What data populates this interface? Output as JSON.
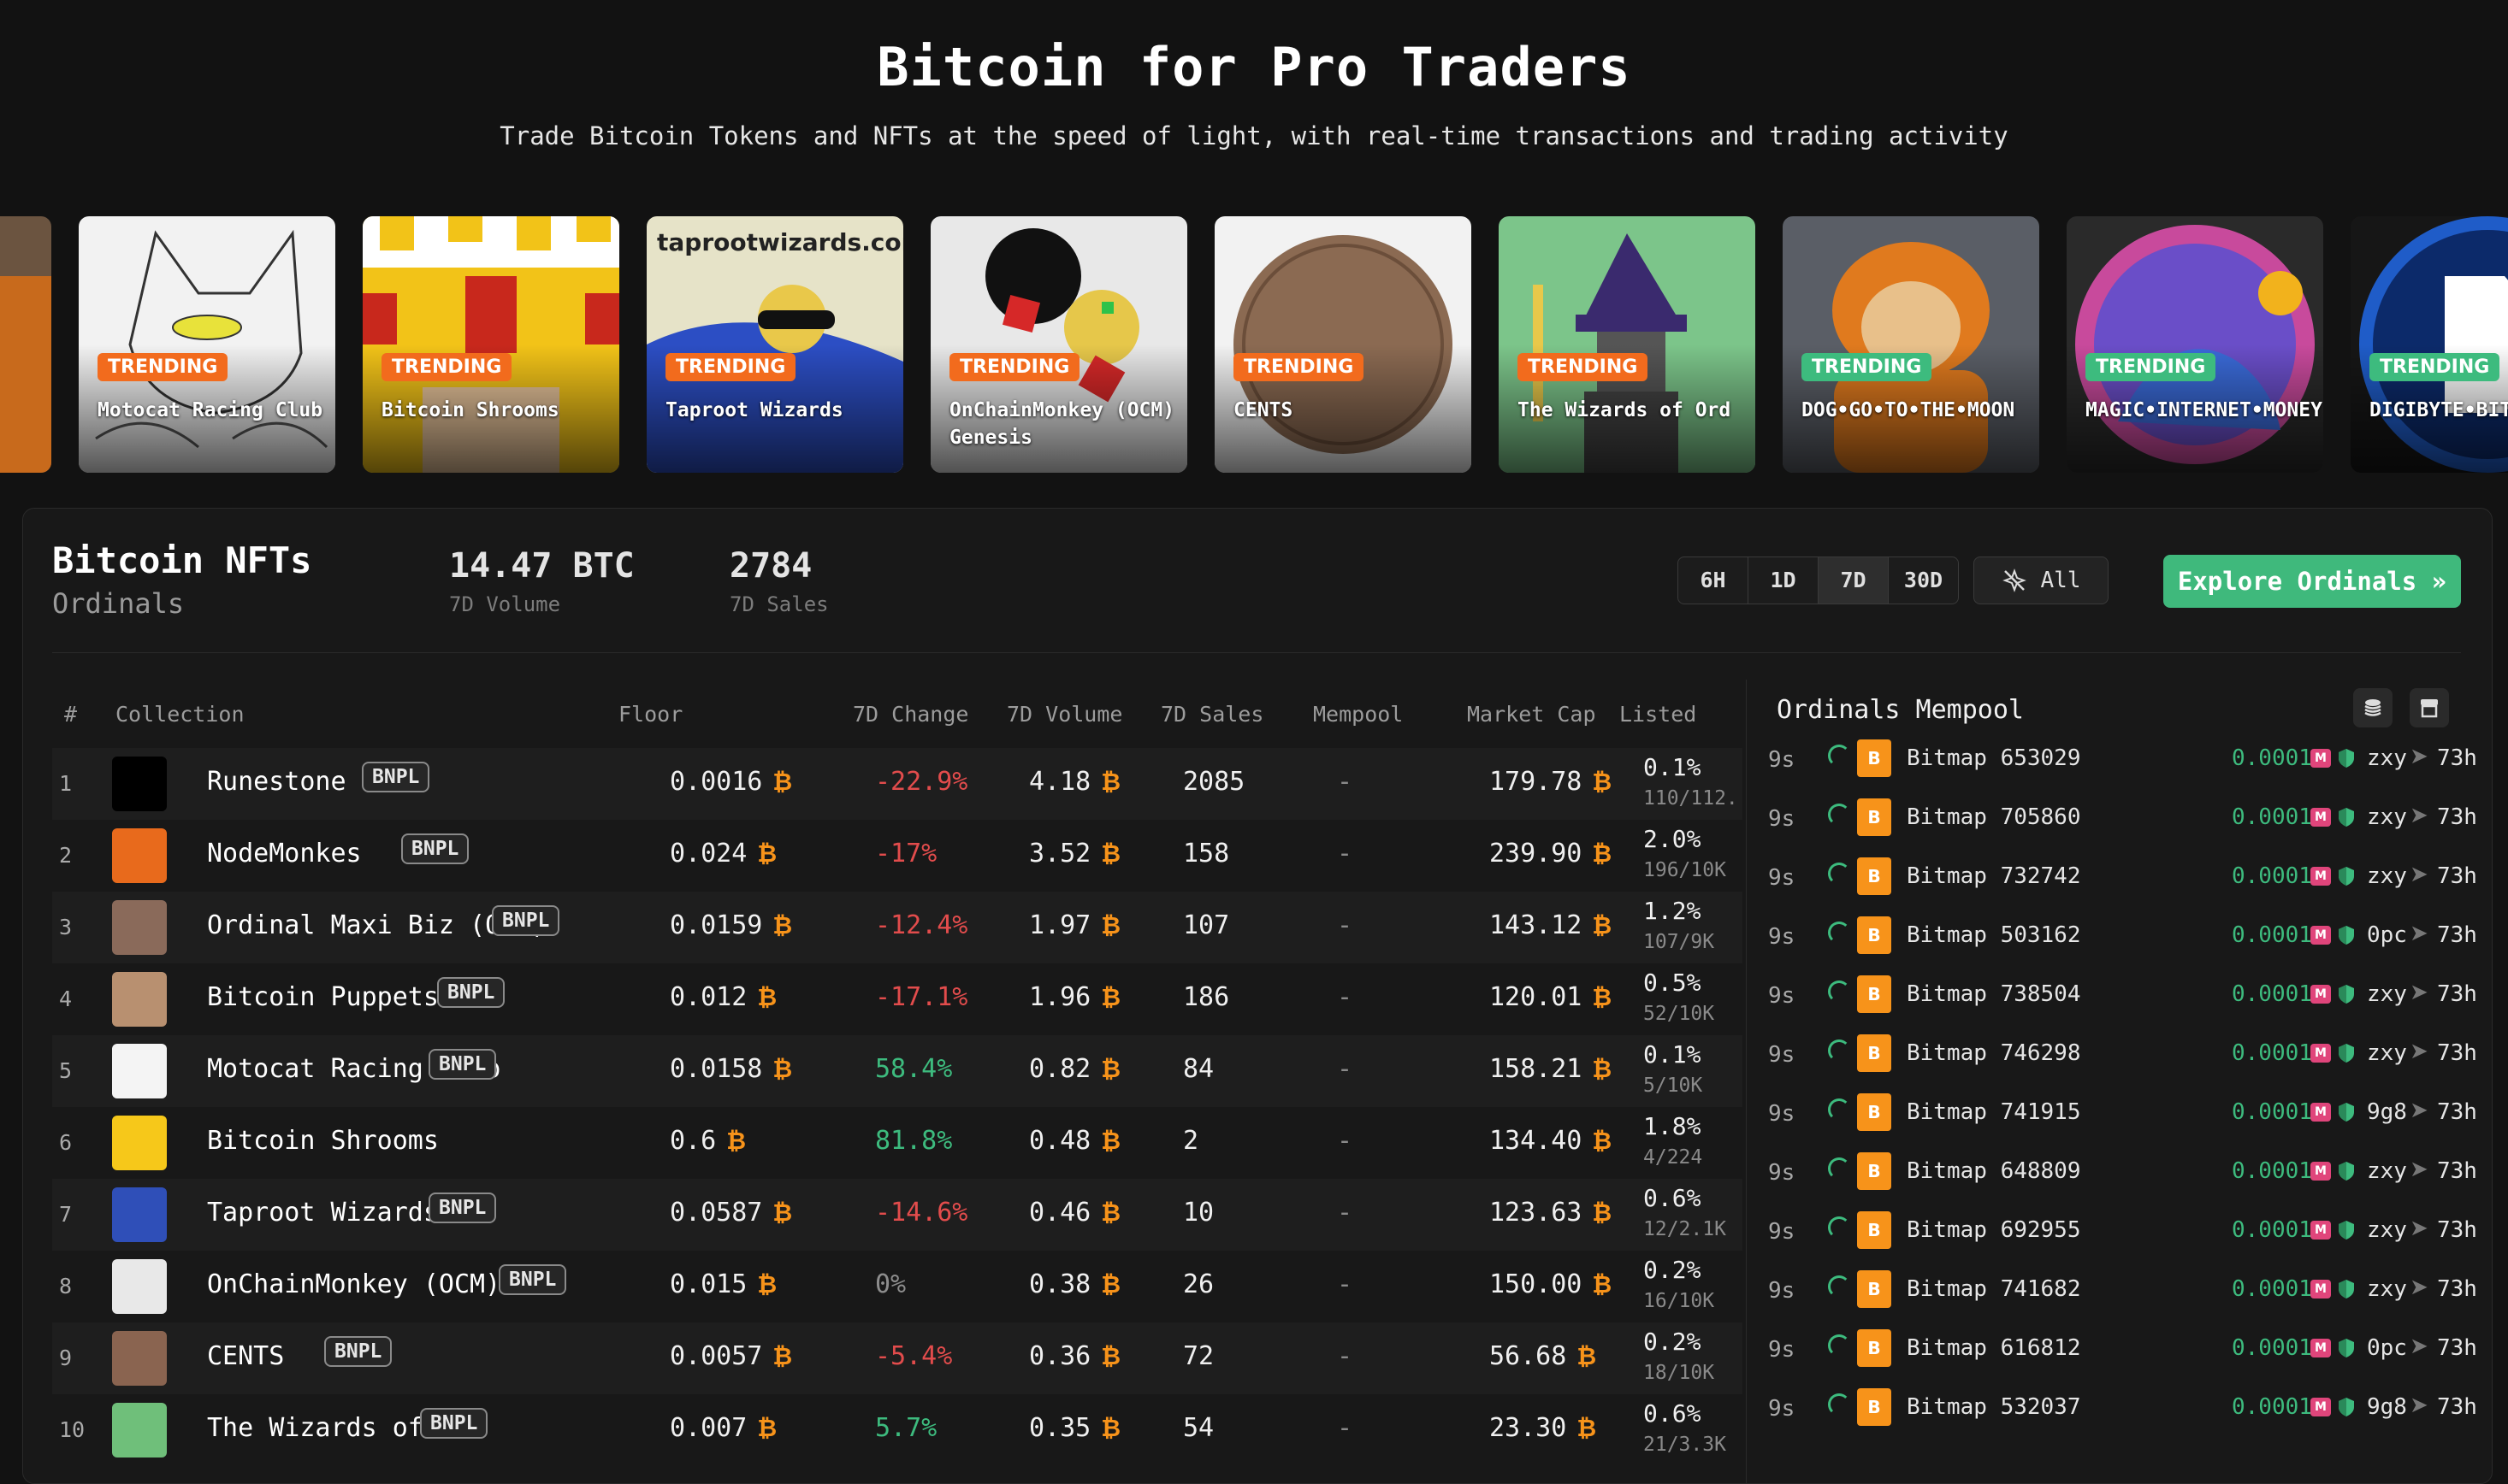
{
  "hero": {
    "title": "Bitcoin for Pro Traders",
    "subtitle": "Trade Bitcoin Tokens and NFTs at the speed of light, with real-time transactions and trading activity"
  },
  "carousel": [
    {
      "badge": "TRENDING",
      "name": "Motocat Racing Club",
      "badge_color": "#f26b1d"
    },
    {
      "badge": "TRENDING",
      "name": "Bitcoin Shrooms",
      "badge_color": "#f26b1d"
    },
    {
      "badge": "TRENDING",
      "name": "Taproot Wizards",
      "badge_color": "#f26b1d",
      "art_text": "taprootwizards.com"
    },
    {
      "badge": "TRENDING",
      "name": "OnChainMonkey (OCM) Genesis",
      "badge_color": "#f26b1d"
    },
    {
      "badge": "TRENDING",
      "name": "CENTS",
      "badge_color": "#f26b1d"
    },
    {
      "badge": "TRENDING",
      "name": "The Wizards of Ord",
      "badge_color": "#f26b1d"
    },
    {
      "badge": "TRENDING",
      "name": "DOG•GO•TO•THE•MOON",
      "badge_color": "#3dbb7e"
    },
    {
      "badge": "TRENDING",
      "name": "MAGIC•INTERNET•MONEY",
      "badge_color": "#3dbb7e"
    },
    {
      "badge": "TRENDING",
      "name": "DIGIBYTE•BITCOIN",
      "badge_color": "#3dbb7e"
    }
  ],
  "panel": {
    "title": "Bitcoin NFTs",
    "subtitle": "Ordinals",
    "volume_value": "14.47 BTC",
    "volume_label": "7D Volume",
    "sales_value": "2784",
    "sales_label": "7D Sales",
    "periods": [
      "6H",
      "1D",
      "7D",
      "30D"
    ],
    "active_period": "7D",
    "all_label": "All",
    "explore_label": "Explore Ordinals »"
  },
  "table": {
    "headers": {
      "rank": "#",
      "collection": "Collection",
      "floor": "Floor",
      "change": "7D Change",
      "volume": "7D Volume",
      "sales": "7D Sales",
      "mempool": "Mempool",
      "mcap": "Market Cap",
      "listed": "Listed"
    },
    "btc_symbol": "₿",
    "rows": [
      {
        "rank": "1",
        "name": "Runestone",
        "bnpl": "BNPL",
        "floor": "0.0016",
        "change": "-22.9%",
        "volume": "4.18",
        "sales": "2085",
        "mempool": "-",
        "mcap": "179.78",
        "listed_pct": "0.1%",
        "listed_count": "110/112.",
        "change_dir": "neg",
        "thumb_color": "#000000"
      },
      {
        "rank": "2",
        "name": "NodeMonkes",
        "bnpl": "BNPL",
        "floor": "0.024",
        "change": "-17%",
        "volume": "3.52",
        "sales": "158",
        "mempool": "-",
        "mcap": "239.90",
        "listed_pct": "2.0%",
        "listed_count": "196/10K",
        "change_dir": "neg",
        "thumb_color": "#e86a1c"
      },
      {
        "rank": "3",
        "name": "Ordinal Maxi Biz (OMB)",
        "bnpl": "BNPL",
        "floor": "0.0159",
        "change": "-12.4%",
        "volume": "1.97",
        "sales": "107",
        "mempool": "-",
        "mcap": "143.12",
        "listed_pct": "1.2%",
        "listed_count": "107/9K",
        "change_dir": "neg",
        "thumb_color": "#8a6a5a"
      },
      {
        "rank": "4",
        "name": "Bitcoin Puppets",
        "bnpl": "BNPL",
        "floor": "0.012",
        "change": "-17.1%",
        "volume": "1.96",
        "sales": "186",
        "mempool": "-",
        "mcap": "120.01",
        "listed_pct": "0.5%",
        "listed_count": "52/10K",
        "change_dir": "neg",
        "thumb_color": "#b89070"
      },
      {
        "rank": "5",
        "name": "Motocat Racing Club",
        "bnpl": "BNPL",
        "floor": "0.0158",
        "change": "58.4%",
        "volume": "0.82",
        "sales": "84",
        "mempool": "-",
        "mcap": "158.21",
        "listed_pct": "0.1%",
        "listed_count": "5/10K",
        "change_dir": "pos",
        "thumb_color": "#f4f4f4"
      },
      {
        "rank": "6",
        "name": "Bitcoin Shrooms",
        "bnpl": "",
        "floor": "0.6",
        "change": "81.8%",
        "volume": "0.48",
        "sales": "2",
        "mempool": "-",
        "mcap": "134.40",
        "listed_pct": "1.8%",
        "listed_count": "4/224",
        "change_dir": "pos",
        "thumb_color": "#f6c81a"
      },
      {
        "rank": "7",
        "name": "Taproot Wizards",
        "bnpl": "BNPL",
        "floor": "0.0587",
        "change": "-14.6%",
        "volume": "0.46",
        "sales": "10",
        "mempool": "-",
        "mcap": "123.63",
        "listed_pct": "0.6%",
        "listed_count": "12/2.1K",
        "change_dir": "neg",
        "thumb_color": "#2f4fb8"
      },
      {
        "rank": "8",
        "name": "OnChainMonkey (OCM) Ge…",
        "bnpl": "BNPL",
        "floor": "0.015",
        "change": "0%",
        "volume": "0.38",
        "sales": "26",
        "mempool": "-",
        "mcap": "150.00",
        "listed_pct": "0.2%",
        "listed_count": "16/10K",
        "change_dir": "zero",
        "thumb_color": "#e8e8e8"
      },
      {
        "rank": "9",
        "name": "CENTS",
        "bnpl": "BNPL",
        "floor": "0.0057",
        "change": "-5.4%",
        "volume": "0.36",
        "sales": "72",
        "mempool": "-",
        "mcap": "56.68",
        "listed_pct": "0.2%",
        "listed_count": "18/10K",
        "change_dir": "neg",
        "thumb_color": "#8a6450"
      },
      {
        "rank": "10",
        "name": "The Wizards of Ord",
        "bnpl": "BNPL",
        "floor": "0.007",
        "change": "5.7%",
        "volume": "0.35",
        "sales": "54",
        "mempool": "-",
        "mcap": "23.30",
        "listed_pct": "0.6%",
        "listed_count": "21/3.3K",
        "change_dir": "pos",
        "thumb_color": "#6fbf7a"
      }
    ]
  },
  "mempool": {
    "title": "Ordinals Mempool",
    "icon_badge": "B",
    "me_badge": "M",
    "arrow": "➤",
    "rows": [
      {
        "age": "9s",
        "name": "Bitmap 653029",
        "price": "0.0001",
        "user": "zxy",
        "time": "73h"
      },
      {
        "age": "9s",
        "name": "Bitmap 705860",
        "price": "0.0001",
        "user": "zxy",
        "time": "73h"
      },
      {
        "age": "9s",
        "name": "Bitmap 732742",
        "price": "0.0001",
        "user": "zxy",
        "time": "73h"
      },
      {
        "age": "9s",
        "name": "Bitmap 503162",
        "price": "0.0001",
        "user": "0pc",
        "time": "73h"
      },
      {
        "age": "9s",
        "name": "Bitmap 738504",
        "price": "0.0001",
        "user": "zxy",
        "time": "73h"
      },
      {
        "age": "9s",
        "name": "Bitmap 746298",
        "price": "0.0001",
        "user": "zxy",
        "time": "73h"
      },
      {
        "age": "9s",
        "name": "Bitmap 741915",
        "price": "0.0001",
        "user": "9g8",
        "time": "73h"
      },
      {
        "age": "9s",
        "name": "Bitmap 648809",
        "price": "0.0001",
        "user": "zxy",
        "time": "73h"
      },
      {
        "age": "9s",
        "name": "Bitmap 692955",
        "price": "0.0001",
        "user": "zxy",
        "time": "73h"
      },
      {
        "age": "9s",
        "name": "Bitmap 741682",
        "price": "0.0001",
        "user": "zxy",
        "time": "73h"
      },
      {
        "age": "9s",
        "name": "Bitmap 616812",
        "price": "0.0001",
        "user": "0pc",
        "time": "73h"
      },
      {
        "age": "9s",
        "name": "Bitmap 532037",
        "price": "0.0001",
        "user": "9g8",
        "time": "73h"
      }
    ]
  }
}
